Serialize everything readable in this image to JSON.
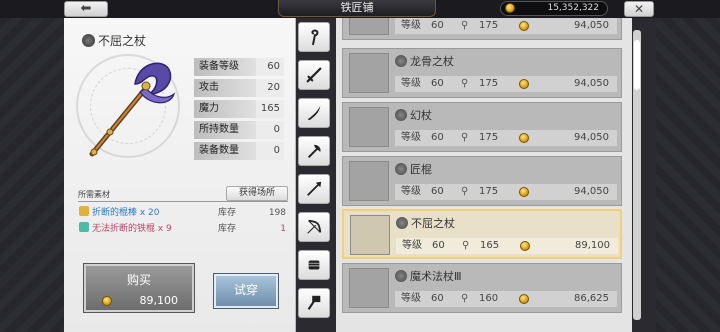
{
  "header": {
    "back_label": "⬅",
    "title": "铁匠铺",
    "gold": "15,352,322",
    "close_label": "✕"
  },
  "detail": {
    "name": "不屈之杖",
    "stats": [
      {
        "label": "装备等级",
        "value": "60"
      },
      {
        "label": "攻击",
        "value": "20"
      },
      {
        "label": "魔力",
        "value": "165"
      },
      {
        "label": "所持数量",
        "value": "0"
      },
      {
        "label": "装备数量",
        "value": "0"
      }
    ],
    "materials_label": "所需素材",
    "where_label": "获得场所",
    "materials": [
      {
        "name": "折断的棍棒 x 20",
        "stock_label": "库存",
        "count": "198",
        "color": "#e3b03a"
      },
      {
        "name": "无法折断的铁棍 x 9",
        "stock_label": "库存",
        "count": "1",
        "color": "#4fb9a6"
      }
    ],
    "buy_label": "购买",
    "buy_price": "89,100",
    "try_label": "试穿"
  },
  "tabs": [
    {
      "name": "staff-tab",
      "icon": "staff-icon"
    },
    {
      "name": "sword-tab",
      "icon": "sword-icon"
    },
    {
      "name": "saber-tab",
      "icon": "saber-icon"
    },
    {
      "name": "axe-tab",
      "icon": "axe-icon"
    },
    {
      "name": "spear-tab",
      "icon": "spear-icon"
    },
    {
      "name": "bow-tab",
      "icon": "bow-icon"
    },
    {
      "name": "fist-tab",
      "icon": "fist-icon"
    },
    {
      "name": "hammer-tab",
      "icon": "hammer-icon"
    }
  ],
  "list": {
    "level_label": "等级",
    "items": [
      {
        "name": "",
        "level": "60",
        "keys": "175",
        "price": "94,050"
      },
      {
        "name": "龙骨之杖",
        "level": "60",
        "keys": "175",
        "price": "94,050"
      },
      {
        "name": "幻杖",
        "level": "60",
        "keys": "175",
        "price": "94,050"
      },
      {
        "name": "匠棍",
        "level": "60",
        "keys": "175",
        "price": "94,050"
      },
      {
        "name": "不屈之杖",
        "level": "60",
        "keys": "165",
        "price": "89,100",
        "selected": true
      },
      {
        "name": "魔术法杖Ⅲ",
        "level": "60",
        "keys": "160",
        "price": "86,625"
      }
    ]
  }
}
